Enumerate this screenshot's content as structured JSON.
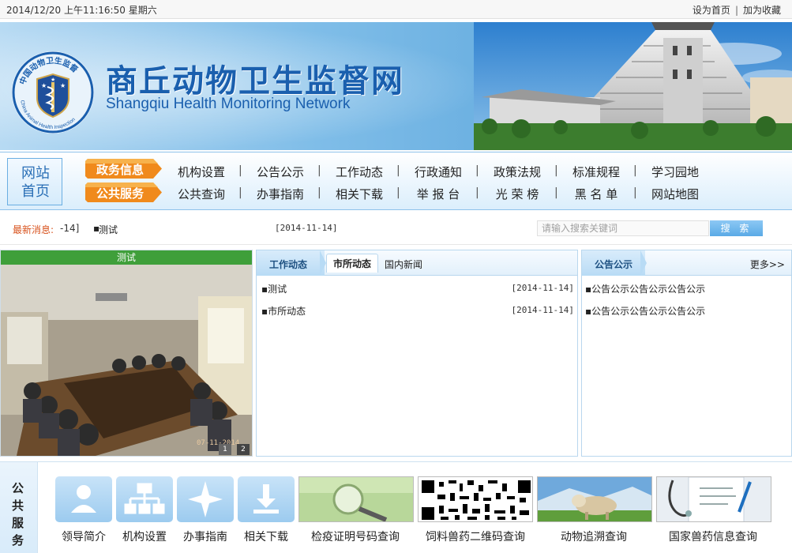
{
  "topbar": {
    "datetime": "2014/12/20 上午11:16:50 星期六",
    "set_home": "设为首页",
    "separator": "|",
    "add_favorite": "加为收藏"
  },
  "header": {
    "title_cn": "商丘动物卫生监督网",
    "title_en": "Shangqiu Health Monitoring Network",
    "logo_ring_text": "中国动物卫生监督",
    "logo_en_text": "China Animal Health Inspection"
  },
  "nav": {
    "home_label": "网站\n首页",
    "tag_government": "政务信息",
    "tag_public": "公共服务",
    "row1": [
      "机构设置",
      "公告公示",
      "工作动态",
      "行政通知",
      "政策法规",
      "标准规程",
      "学习园地"
    ],
    "row2": [
      "公共查询",
      "办事指南",
      "相关下载",
      "举 报 台",
      "光 荣 榜",
      "黑 名 单",
      "网站地图"
    ],
    "separator": "|"
  },
  "ticker": {
    "label": "最新消息:",
    "count": "-14]",
    "bullet": "▪",
    "title": "测试",
    "date": "[2014-11-14]"
  },
  "search": {
    "placeholder": "请输入搜索关键词",
    "button_label": "搜 索"
  },
  "photo": {
    "caption": "测试",
    "pages": [
      "1",
      "2"
    ]
  },
  "news": {
    "tab_main": "工作动态",
    "tab_city": "市所动态",
    "tab_national": "国内新闻",
    "items": [
      {
        "title": "▪测试",
        "date": "[2014-11-14]"
      },
      {
        "title": "▪市所动态",
        "date": "[2014-11-14]"
      }
    ]
  },
  "notice": {
    "title": "公告公示",
    "more": "更多>>",
    "items": [
      "▪公告公示公告公示公告公示",
      "▪公告公示公告公示公告公示"
    ]
  },
  "services": {
    "label": "公共服务",
    "items": [
      {
        "label": "领导简介",
        "icon": "person-icon"
      },
      {
        "label": "机构设置",
        "icon": "org-chart-icon"
      },
      {
        "label": "办事指南",
        "icon": "compass-star-icon"
      },
      {
        "label": "相关下载",
        "icon": "download-icon"
      },
      {
        "label": "检疫证明号码查询",
        "icon": "magnifier-image"
      },
      {
        "label": "饲料兽药二维码查询",
        "icon": "qr-code-image"
      },
      {
        "label": "动物追溯查询",
        "icon": "cow-image"
      },
      {
        "label": "国家兽药信息查询",
        "icon": "medical-image"
      }
    ]
  },
  "colors": {
    "brand_blue": "#1a5fae",
    "nav_tag_orange": "#f08a1c",
    "caption_green": "#3f9f3a",
    "ticker_label": "#d8531e"
  }
}
